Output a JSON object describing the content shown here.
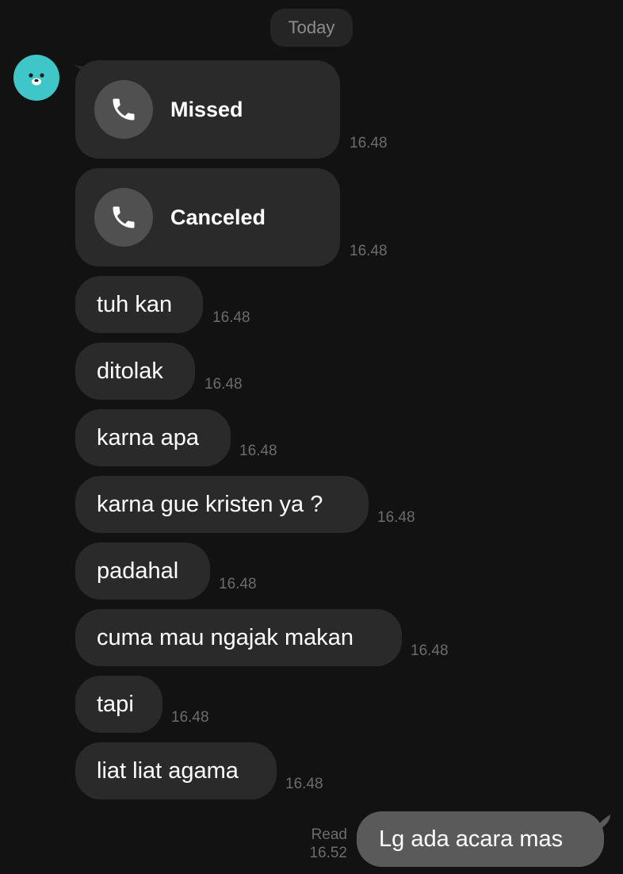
{
  "date_separator": "Today",
  "calls": [
    {
      "label": "Missed",
      "time": "16.48",
      "icon": "phone-icon"
    },
    {
      "label": "Canceled",
      "time": "16.48",
      "icon": "phone-icon"
    }
  ],
  "messages": [
    {
      "text": "tuh kan",
      "time": "16.48"
    },
    {
      "text": "ditolak",
      "time": "16.48"
    },
    {
      "text": "karna apa",
      "time": "16.48"
    },
    {
      "text": "karna gue kristen ya ?",
      "time": "16.48"
    },
    {
      "text": "padahal",
      "time": "16.48"
    },
    {
      "text": "cuma mau ngajak makan",
      "time": "16.48"
    },
    {
      "text": "tapi",
      "time": "16.48"
    },
    {
      "text": "liat liat agama",
      "time": "16.48"
    }
  ],
  "own_message": {
    "text": "Lg ada acara mas",
    "status": "Read",
    "time": "16.52"
  },
  "colors": {
    "background": "#121212",
    "incoming_bubble": "#2a2a2a",
    "outgoing_bubble": "#5a5a5a",
    "avatar": "#3fc6c8"
  }
}
